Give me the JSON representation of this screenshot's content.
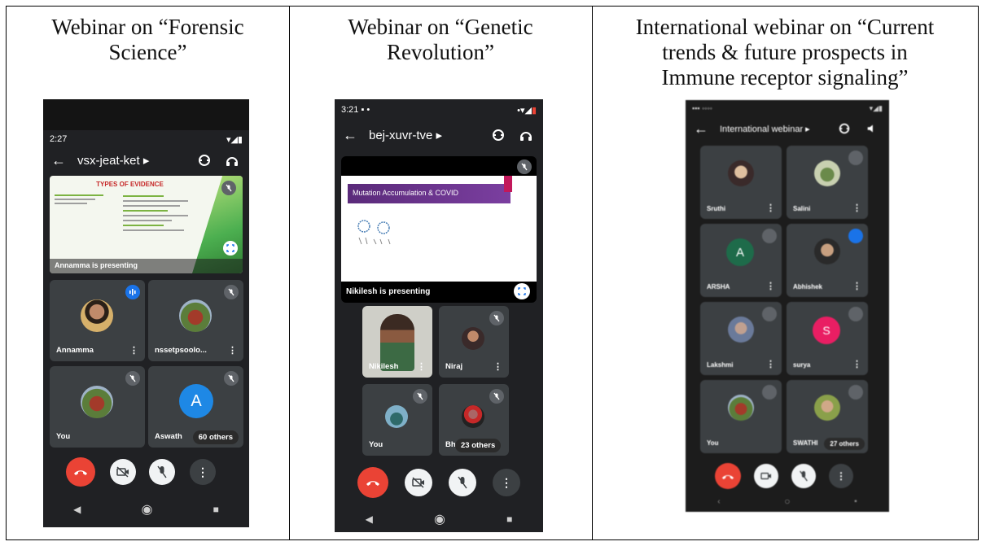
{
  "captions": {
    "forensic": "Webinar on “Forensic Science”",
    "forensic_l1": "Webinar on “Forensic",
    "forensic_l2": "Science”",
    "genetic_l1": "Webinar on “Genetic",
    "genetic_l2": "Revolution”",
    "immune_l1": "International webinar on “Current",
    "immune_l2": "trends & future prospects in",
    "immune_l3": "Immune receptor signaling”"
  },
  "phone1": {
    "time": "2:27",
    "meeting_code": "vsx-jeat-ket ▸",
    "slide_title": "TYPES OF EVIDENCE",
    "presenting": "Annamma is presenting",
    "tiles": [
      {
        "name": "Annamma"
      },
      {
        "name": "nssetpsoolo..."
      },
      {
        "name": "You"
      },
      {
        "name": "Aswath",
        "avatar_letter": "A"
      }
    ],
    "others": "60 others"
  },
  "phone2": {
    "time": "3:21",
    "meeting_code": "bej-xuvr-tve ▸",
    "slide_title": "Mutation Accumulation & COVID",
    "presenting": "Nikilesh is presenting",
    "tiles": [
      {
        "name": "Nikilesh"
      },
      {
        "name": "Niraj"
      },
      {
        "name": "You"
      },
      {
        "name": "Bh"
      }
    ],
    "others": "23 others"
  },
  "phone3": {
    "meeting_code": "International webinar ▸",
    "tiles": [
      {
        "name": "Sruthi"
      },
      {
        "name": "Salini"
      },
      {
        "name": "ARSHA",
        "avatar_letter": "A"
      },
      {
        "name": "Abhishek"
      },
      {
        "name": "Lakshmi"
      },
      {
        "name": "surya",
        "avatar_letter": "S"
      },
      {
        "name": "You"
      },
      {
        "name": "SWATHI"
      }
    ],
    "others": "27 others"
  },
  "colors": {
    "end_call": "#ea4335",
    "tile_bg": "#3c4043",
    "speaking": "#1a73e8",
    "avatar_blue": "#1e88e5",
    "avatar_green": "#1e6b4a",
    "avatar_pink": "#e91e63"
  }
}
